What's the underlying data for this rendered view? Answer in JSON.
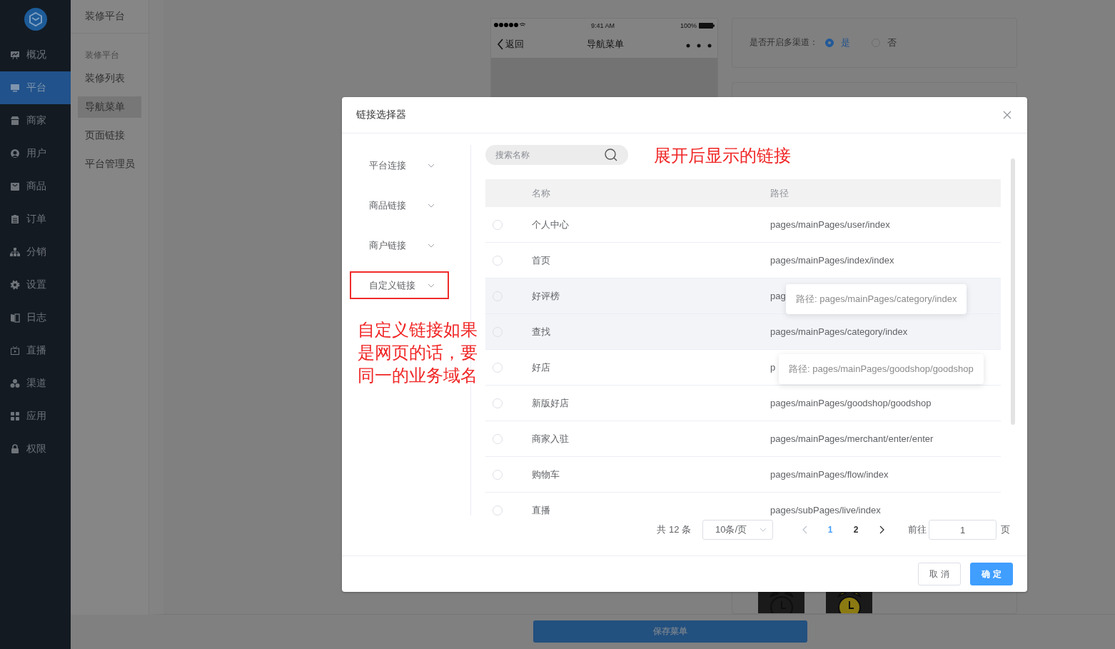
{
  "sidebar": {
    "items": [
      {
        "label": "概况",
        "selected": false
      },
      {
        "label": "平台",
        "selected": true
      },
      {
        "label": "商家",
        "selected": false
      },
      {
        "label": "用户",
        "selected": false
      },
      {
        "label": "商品",
        "selected": false
      },
      {
        "label": "订单",
        "selected": false
      },
      {
        "label": "分销",
        "selected": false
      },
      {
        "label": "设置",
        "selected": false
      },
      {
        "label": "日志",
        "selected": false
      },
      {
        "label": "直播",
        "selected": false
      },
      {
        "label": "渠道",
        "selected": false
      },
      {
        "label": "应用",
        "selected": false
      },
      {
        "label": "权限",
        "selected": false
      }
    ]
  },
  "submenu": {
    "title": "装修平台",
    "group": "装修平台",
    "items": [
      {
        "label": "装修列表",
        "selected": false
      },
      {
        "label": "导航菜单",
        "selected": true
      },
      {
        "label": "页面链接",
        "selected": false
      },
      {
        "label": "平台管理员",
        "selected": false
      }
    ]
  },
  "phone": {
    "time": "9:41 AM",
    "battery": "100%",
    "back": "返回",
    "title": "导航菜单"
  },
  "channel_setting": {
    "label": "是否开启多渠道：",
    "options": [
      {
        "label": "是",
        "selected": true
      },
      {
        "label": "否",
        "selected": false
      }
    ]
  },
  "save_button": "保存菜单",
  "modal": {
    "title": "链接选择器",
    "categories": [
      {
        "label": "平台连接",
        "highlighted": false
      },
      {
        "label": "商品链接",
        "highlighted": false
      },
      {
        "label": "商户链接",
        "highlighted": false
      },
      {
        "label": "自定义链接",
        "highlighted": true
      }
    ],
    "note_left": "自定义链接如果是网页的话，要同一的业务域名",
    "note_top": "展开后显示的链接",
    "search": {
      "placeholder": "搜索名称"
    },
    "table": {
      "columns": [
        "名称",
        "路径"
      ],
      "rows": [
        {
          "name": "个人中心",
          "path": "pages/mainPages/user/index",
          "selected": false,
          "hovered": false
        },
        {
          "name": "首页",
          "path": "pages/mainPages/index/index",
          "selected": false,
          "hovered": false
        },
        {
          "name": "好评榜",
          "path": "pag",
          "selected": false,
          "hovered": true,
          "tooltip": "路径: pages/mainPages/category/index"
        },
        {
          "name": "查找",
          "path": "pages/mainPages/category/index",
          "selected": false,
          "hovered": true
        },
        {
          "name": "好店",
          "path": "p",
          "selected": false,
          "hovered": false,
          "tooltip": "路径: pages/mainPages/goodshop/goodshop"
        },
        {
          "name": "新版好店",
          "path": "pages/mainPages/goodshop/goodshop",
          "selected": false,
          "hovered": false
        },
        {
          "name": "商家入驻",
          "path": "pages/mainPages/merchant/enter/enter",
          "selected": false,
          "hovered": false
        },
        {
          "name": "购物车",
          "path": "pages/mainPages/flow/index",
          "selected": false,
          "hovered": false
        },
        {
          "name": "直播",
          "path": "pages/subPages/live/index",
          "selected": false,
          "hovered": false
        }
      ]
    },
    "pagination": {
      "total": "共 12 条",
      "page_size": "10条/页",
      "pages": [
        {
          "label": "1",
          "selected": true
        },
        {
          "label": "2",
          "selected": false
        }
      ],
      "goto_label": "前往",
      "goto_value": "1",
      "goto_suffix": "页"
    },
    "buttons": [
      {
        "label": "取 消",
        "kind": "default"
      },
      {
        "label": "确 定",
        "kind": "primary"
      }
    ]
  }
}
